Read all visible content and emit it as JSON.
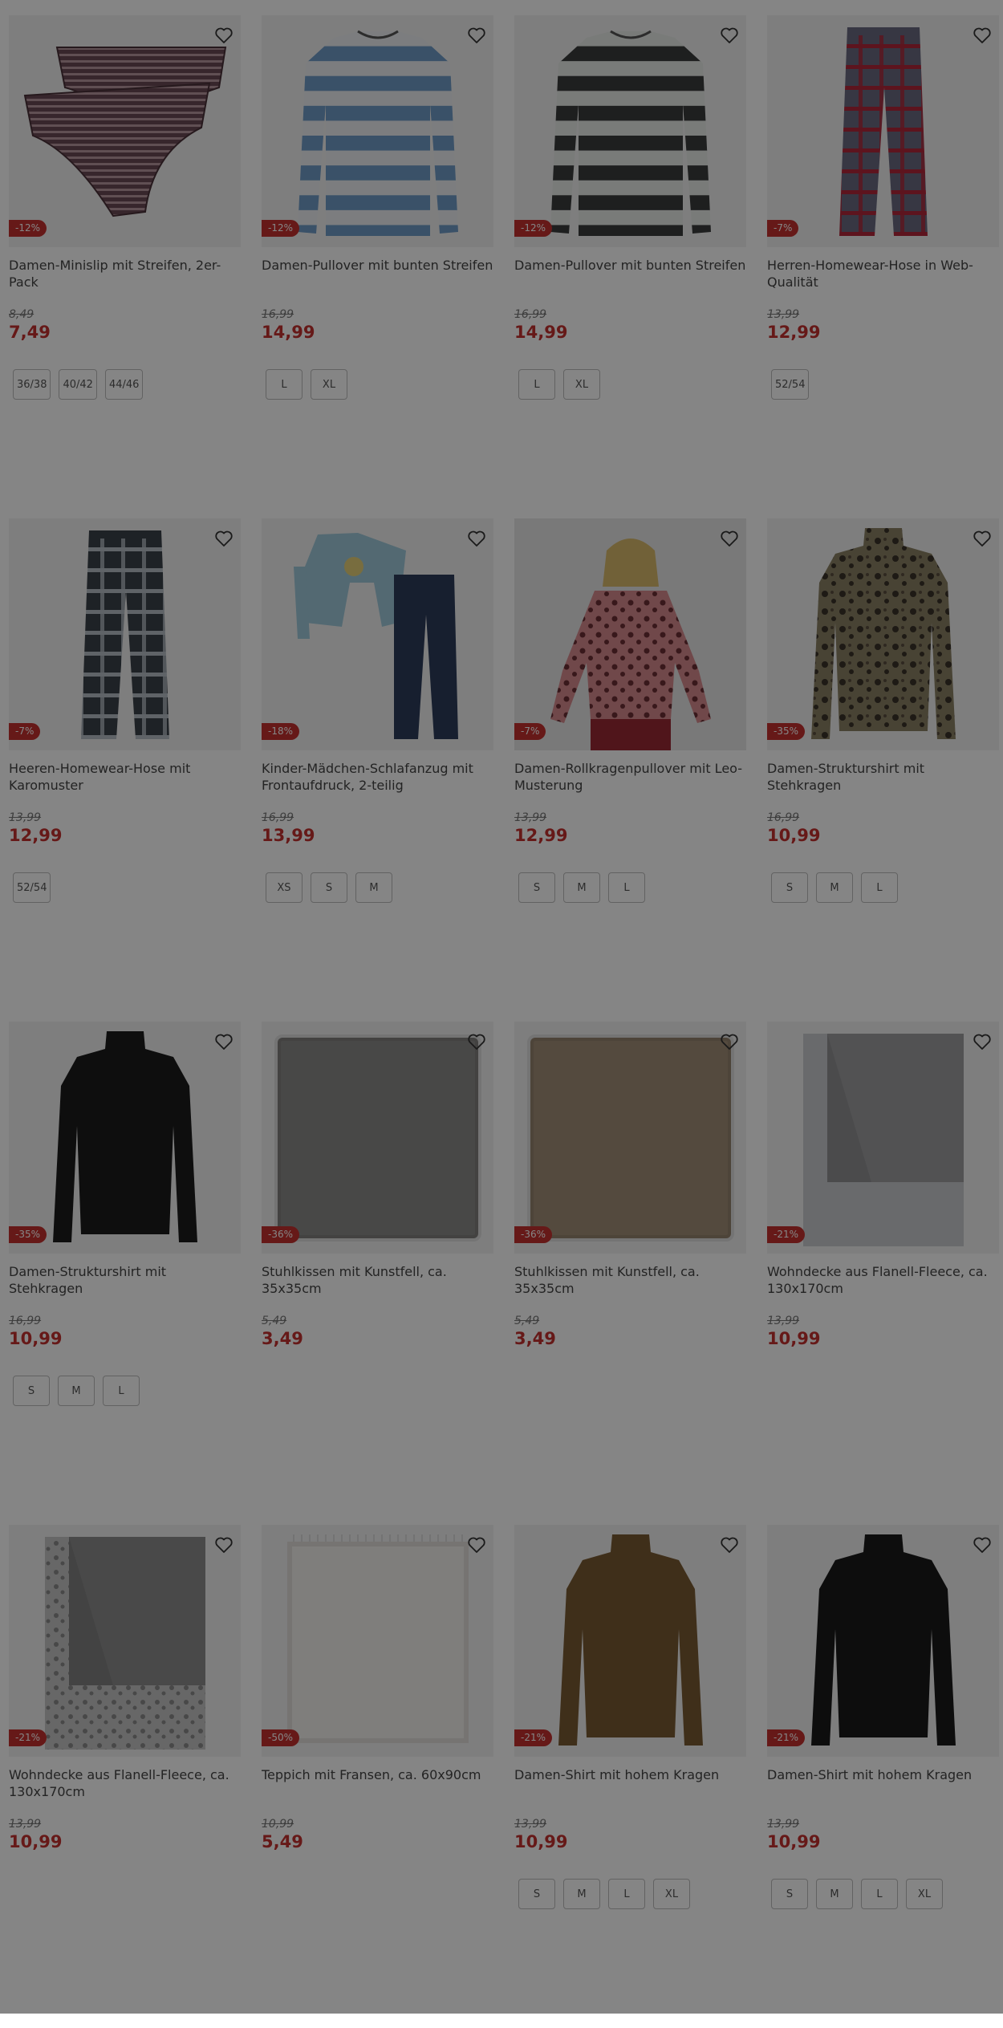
{
  "colors": {
    "sale": "#c3312f",
    "overlay": "rgba(0,0,0,0.48)"
  },
  "products": [
    {
      "id": "p1",
      "art": "briefs",
      "badge": "-12%",
      "title": "Damen-Minislip mit Streifen, 2er-Pack",
      "old_price": "8,49",
      "price": "7,49",
      "sizes": [
        "36/38",
        "40/42",
        "44/46"
      ]
    },
    {
      "id": "p2",
      "art": "sweater-blue",
      "badge": "-12%",
      "title": "Damen-Pullover mit bunten Streifen",
      "old_price": "16,99",
      "price": "14,99",
      "sizes": [
        "L",
        "XL"
      ]
    },
    {
      "id": "p3",
      "art": "sweater-dark",
      "badge": "-12%",
      "title": "Damen-Pullover mit bunten Streifen",
      "old_price": "16,99",
      "price": "14,99",
      "sizes": [
        "L",
        "XL"
      ]
    },
    {
      "id": "p4",
      "art": "pants-red",
      "badge": "-7%",
      "title": "Herren-Homewear-Hose in Web-Qualität",
      "old_price": "13,99",
      "price": "12,99",
      "sizes": [
        "52/54"
      ]
    },
    {
      "id": "p5",
      "art": "pants-dark",
      "badge": "-7%",
      "title": "Heeren-Homewear-Hose mit Karomuster",
      "old_price": "13,99",
      "price": "12,99",
      "sizes": [
        "52/54"
      ]
    },
    {
      "id": "p6",
      "art": "pajama",
      "badge": "-18%",
      "title": "Kinder-Mädchen-Schlafanzug mit Frontaufdruck, 2-teilig",
      "old_price": "16,99",
      "price": "13,99",
      "sizes": [
        "XS",
        "S",
        "M"
      ]
    },
    {
      "id": "p7",
      "art": "leo-model",
      "badge": "-7%",
      "title": "Damen-Rollkragenpullover mit Leo-Musterung",
      "old_price": "13,99",
      "price": "12,99",
      "sizes": [
        "S",
        "M",
        "L"
      ]
    },
    {
      "id": "p8",
      "art": "leo-turtle",
      "badge": "-35%",
      "title": "Damen-Strukturshirt mit Stehkragen",
      "old_price": "16,99",
      "price": "10,99",
      "sizes": [
        "S",
        "M",
        "L"
      ]
    },
    {
      "id": "p9",
      "art": "black-turtle",
      "badge": "-35%",
      "title": "Damen-Strukturshirt mit Stehkragen",
      "old_price": "16,99",
      "price": "10,99",
      "sizes": [
        "S",
        "M",
        "L"
      ]
    },
    {
      "id": "p10",
      "art": "cushion-grey",
      "badge": "-36%",
      "title": "Stuhlkissen mit Kunstfell, ca. 35x35cm",
      "old_price": "5,49",
      "price": "3,49",
      "sizes": []
    },
    {
      "id": "p11",
      "art": "cushion-tan",
      "badge": "-36%",
      "title": "Stuhlkissen mit Kunstfell, ca. 35x35cm",
      "old_price": "5,49",
      "price": "3,49",
      "sizes": []
    },
    {
      "id": "p12",
      "art": "blanket-grey",
      "badge": "-21%",
      "title": "Wohndecke aus Flanell-Fleece, ca. 130x170cm",
      "old_price": "13,99",
      "price": "10,99",
      "sizes": []
    },
    {
      "id": "p13",
      "art": "blanket-leo",
      "badge": "-21%",
      "title": "Wohndecke aus Flanell-Fleece, ca. 130x170cm",
      "old_price": "13,99",
      "price": "10,99",
      "sizes": []
    },
    {
      "id": "p14",
      "art": "rug",
      "badge": "-50%",
      "title": "Teppich mit Fransen, ca. 60x90cm",
      "old_price": "10,99",
      "price": "5,49",
      "sizes": []
    },
    {
      "id": "p15",
      "art": "shirt-brown",
      "badge": "-21%",
      "title": "Damen-Shirt mit hohem Kragen",
      "old_price": "13,99",
      "price": "10,99",
      "sizes": [
        "S",
        "M",
        "L",
        "XL"
      ]
    },
    {
      "id": "p16",
      "art": "shirt-black",
      "badge": "-21%",
      "title": "Damen-Shirt mit hohem Kragen",
      "old_price": "13,99",
      "price": "10,99",
      "sizes": [
        "S",
        "M",
        "L",
        "XL"
      ]
    }
  ]
}
